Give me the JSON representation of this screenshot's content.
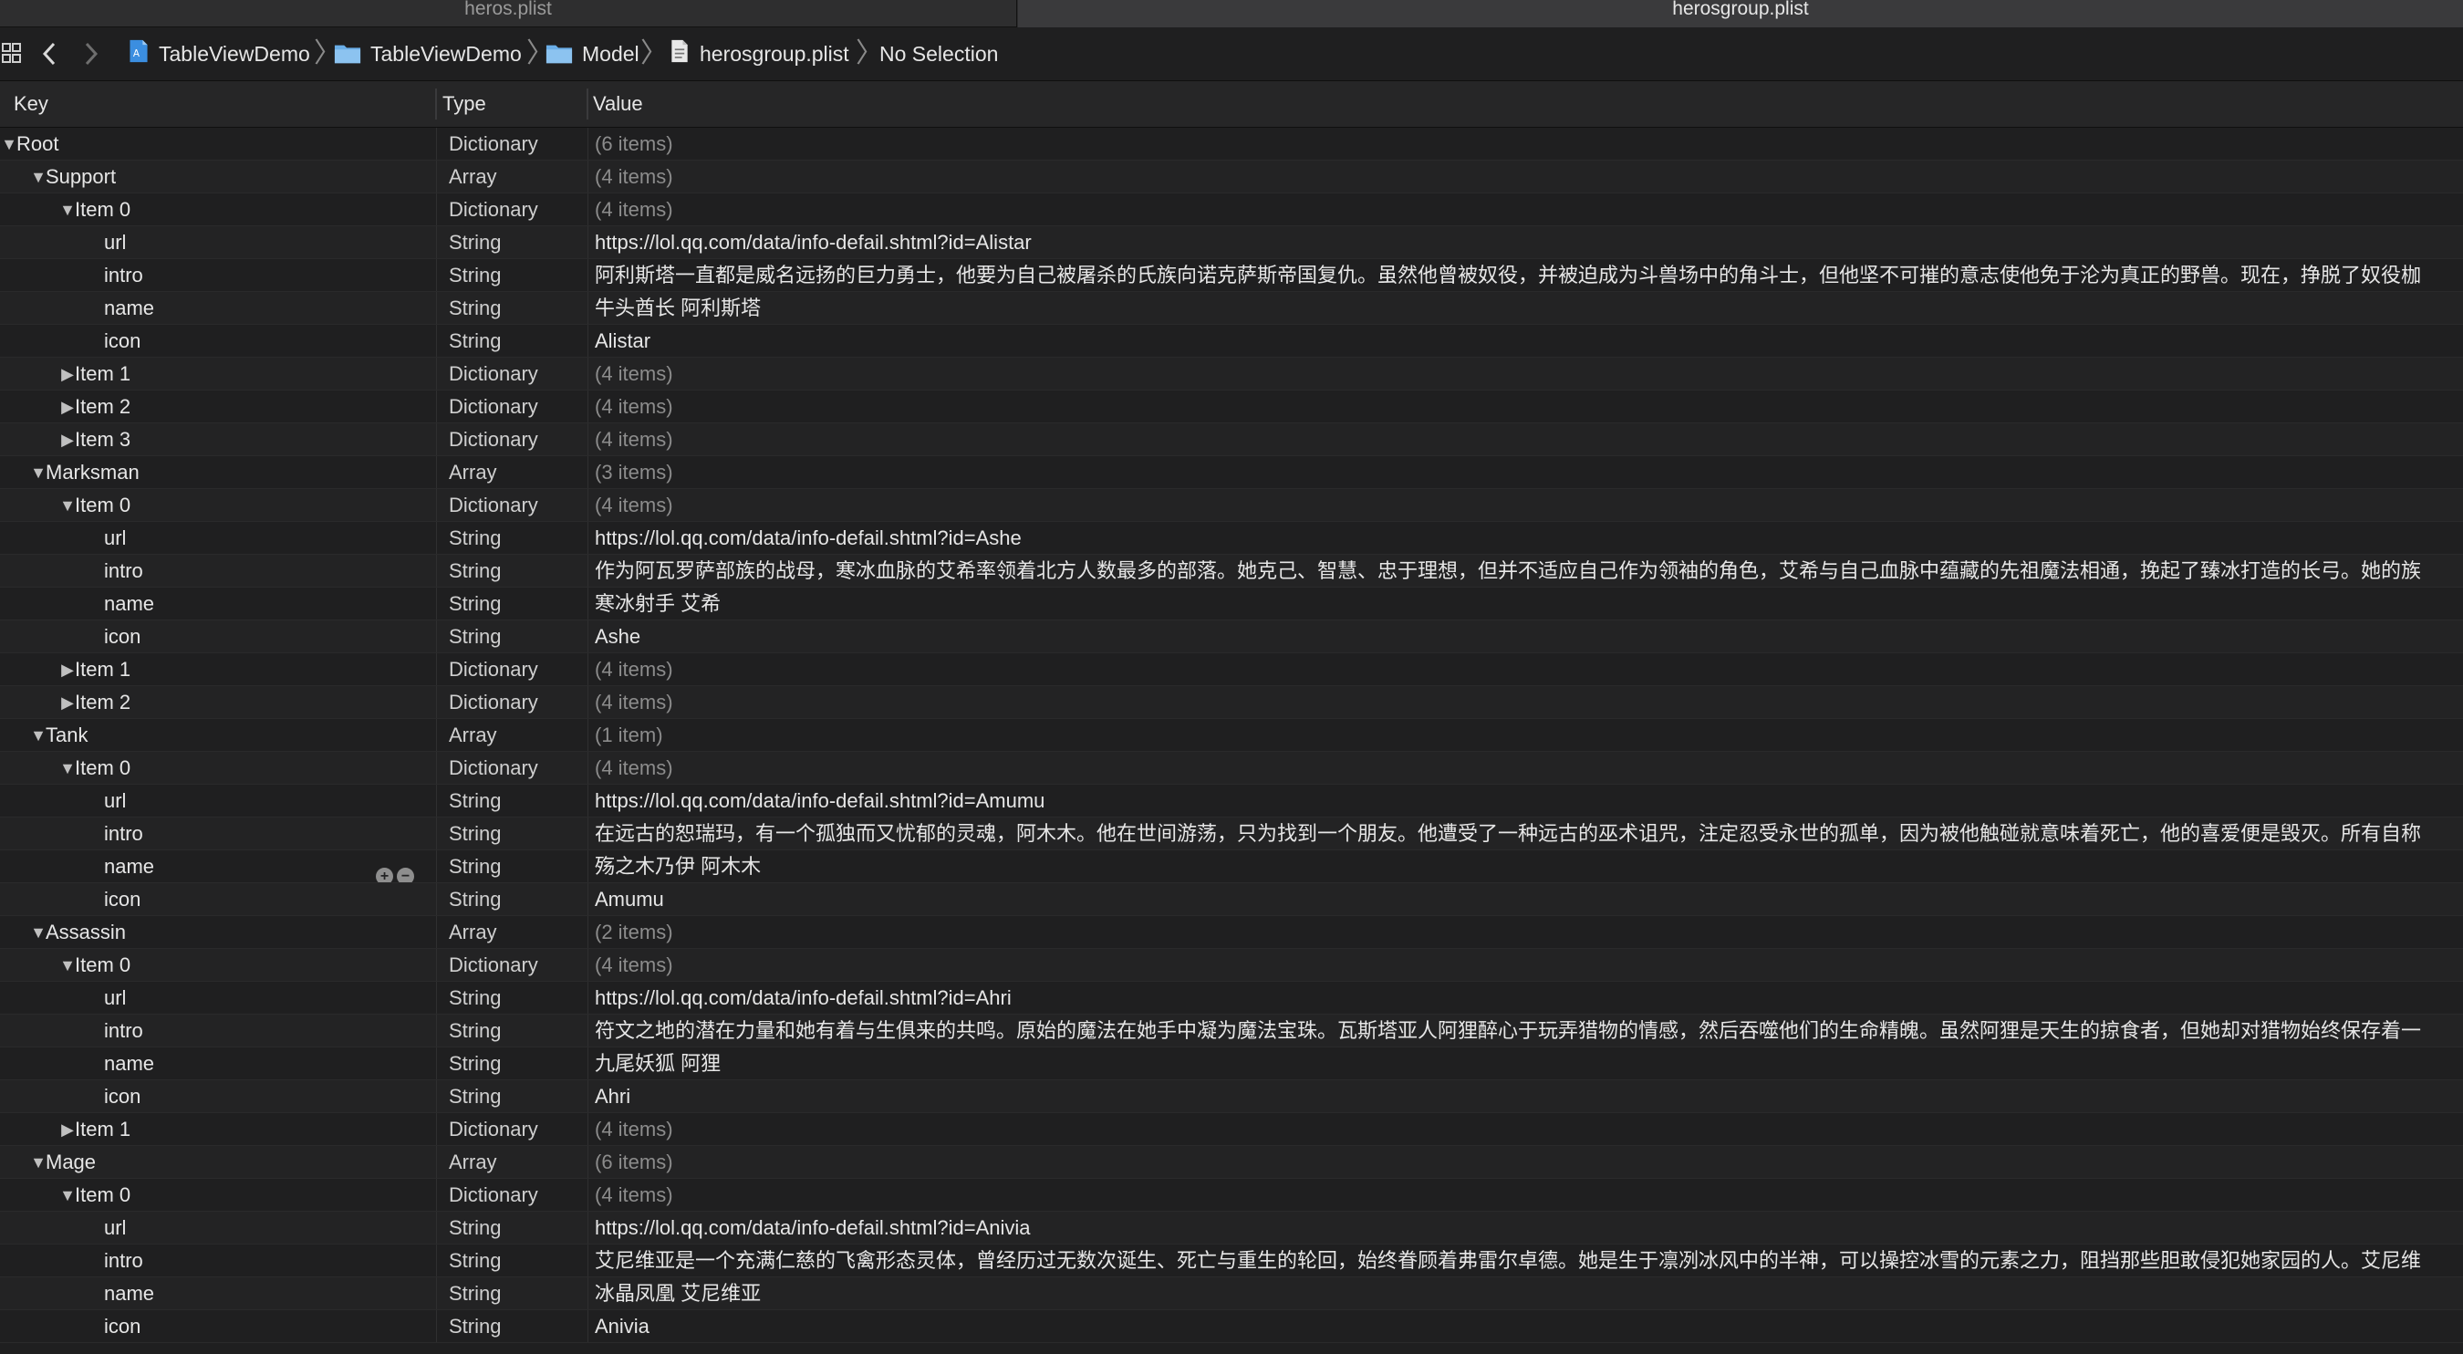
{
  "tabs": [
    {
      "label": "heros.plist",
      "active": false
    },
    {
      "label": "herosgroup.plist",
      "active": true
    }
  ],
  "jump_bar": {
    "crumbs": [
      "TableViewDemo",
      "TableViewDemo",
      "Model",
      "herosgroup.plist",
      "No Selection"
    ]
  },
  "columns": {
    "key": "Key",
    "type": "Type",
    "value": "Value"
  },
  "colors": {
    "background": "#1f1f20",
    "folder": "#6aaee8",
    "project": "#3b8ee0"
  },
  "rows": [
    {
      "key": "Root",
      "type": "Dictionary",
      "value": "(6 items)",
      "level": 0,
      "toggle": "open"
    },
    {
      "key": "Support",
      "type": "Array",
      "value": "(4 items)",
      "level": 1,
      "toggle": "open"
    },
    {
      "key": "Item 0",
      "type": "Dictionary",
      "value": "(4 items)",
      "level": 2,
      "toggle": "open"
    },
    {
      "key": "url",
      "type": "String",
      "value": "https://lol.qq.com/data/info-defail.shtml?id=Alistar",
      "level": 3
    },
    {
      "key": "intro",
      "type": "String",
      "value": "阿利斯塔一直都是威名远扬的巨力勇士，他要为自己被屠杀的氏族向诺克萨斯帝国复仇。虽然他曾被奴役，并被迫成为斗兽场中的角斗士，但他坚不可摧的意志使他免于沦为真正的野兽。现在，挣脱了奴役枷",
      "level": 3
    },
    {
      "key": "name",
      "type": "String",
      "value": "牛头酋长 阿利斯塔",
      "level": 3
    },
    {
      "key": "icon",
      "type": "String",
      "value": "Alistar",
      "level": 3
    },
    {
      "key": "Item 1",
      "type": "Dictionary",
      "value": "(4 items)",
      "level": 2,
      "toggle": "closed"
    },
    {
      "key": "Item 2",
      "type": "Dictionary",
      "value": "(4 items)",
      "level": 2,
      "toggle": "closed"
    },
    {
      "key": "Item 3",
      "type": "Dictionary",
      "value": "(4 items)",
      "level": 2,
      "toggle": "closed"
    },
    {
      "key": "Marksman",
      "type": "Array",
      "value": "(3 items)",
      "level": 1,
      "toggle": "open"
    },
    {
      "key": "Item 0",
      "type": "Dictionary",
      "value": "(4 items)",
      "level": 2,
      "toggle": "open"
    },
    {
      "key": "url",
      "type": "String",
      "value": "https://lol.qq.com/data/info-defail.shtml?id=Ashe",
      "level": 3
    },
    {
      "key": "intro",
      "type": "String",
      "value": "作为阿瓦罗萨部族的战母，寒冰血脉的艾希率领着北方人数最多的部落。她克己、智慧、忠于理想，但并不适应自己作为领袖的角色，艾希与自己血脉中蕴藏的先祖魔法相通，挽起了臻冰打造的长弓。她的族",
      "level": 3
    },
    {
      "key": "name",
      "type": "String",
      "value": "寒冰射手 艾希",
      "level": 3
    },
    {
      "key": "icon",
      "type": "String",
      "value": "Ashe",
      "level": 3
    },
    {
      "key": "Item 1",
      "type": "Dictionary",
      "value": "(4 items)",
      "level": 2,
      "toggle": "closed"
    },
    {
      "key": "Item 2",
      "type": "Dictionary",
      "value": "(4 items)",
      "level": 2,
      "toggle": "closed"
    },
    {
      "key": "Tank",
      "type": "Array",
      "value": "(1 item)",
      "level": 1,
      "toggle": "open"
    },
    {
      "key": "Item 0",
      "type": "Dictionary",
      "value": "(4 items)",
      "level": 2,
      "toggle": "open"
    },
    {
      "key": "url",
      "type": "String",
      "value": "https://lol.qq.com/data/info-defail.shtml?id=Amumu",
      "level": 3
    },
    {
      "key": "intro",
      "type": "String",
      "value": "在远古的恕瑞玛，有一个孤独而又忧郁的灵魂，阿木木。他在世间游荡，只为找到一个朋友。他遭受了一种远古的巫术诅咒，注定忍受永世的孤单，因为被他触碰就意味着死亡，他的喜爱便是毁灭。所有自称",
      "level": 3
    },
    {
      "key": "name",
      "type": "String",
      "value": "殇之木乃伊 阿木木",
      "level": 3,
      "controls": true
    },
    {
      "key": "icon",
      "type": "String",
      "value": "Amumu",
      "level": 3
    },
    {
      "key": "Assassin",
      "type": "Array",
      "value": "(2 items)",
      "level": 1,
      "toggle": "open"
    },
    {
      "key": "Item 0",
      "type": "Dictionary",
      "value": "(4 items)",
      "level": 2,
      "toggle": "open"
    },
    {
      "key": "url",
      "type": "String",
      "value": "https://lol.qq.com/data/info-defail.shtml?id=Ahri",
      "level": 3
    },
    {
      "key": "intro",
      "type": "String",
      "value": "符文之地的潜在力量和她有着与生俱来的共鸣。原始的魔法在她手中凝为魔法宝珠。瓦斯塔亚人阿狸醉心于玩弄猎物的情感，然后吞噬他们的生命精魄。虽然阿狸是天生的掠食者，但她却对猎物始终保存着一",
      "level": 3
    },
    {
      "key": "name",
      "type": "String",
      "value": "九尾妖狐 阿狸",
      "level": 3
    },
    {
      "key": "icon",
      "type": "String",
      "value": "Ahri",
      "level": 3
    },
    {
      "key": "Item 1",
      "type": "Dictionary",
      "value": "(4 items)",
      "level": 2,
      "toggle": "closed"
    },
    {
      "key": "Mage",
      "type": "Array",
      "value": "(6 items)",
      "level": 1,
      "toggle": "open"
    },
    {
      "key": "Item 0",
      "type": "Dictionary",
      "value": "(4 items)",
      "level": 2,
      "toggle": "open"
    },
    {
      "key": "url",
      "type": "String",
      "value": "https://lol.qq.com/data/info-defail.shtml?id=Anivia",
      "level": 3
    },
    {
      "key": "intro",
      "type": "String",
      "value": "艾尼维亚是一个充满仁慈的飞禽形态灵体，曾经历过无数次诞生、死亡与重生的轮回，始终眷顾着弗雷尔卓德。她是生于凛冽冰风中的半神，可以操控冰雪的元素之力，阻挡那些胆敢侵犯她家园的人。艾尼维",
      "level": 3
    },
    {
      "key": "name",
      "type": "String",
      "value": "冰晶凤凰 艾尼维亚",
      "level": 3
    },
    {
      "key": "icon",
      "type": "String",
      "value": "Anivia",
      "level": 3
    }
  ]
}
